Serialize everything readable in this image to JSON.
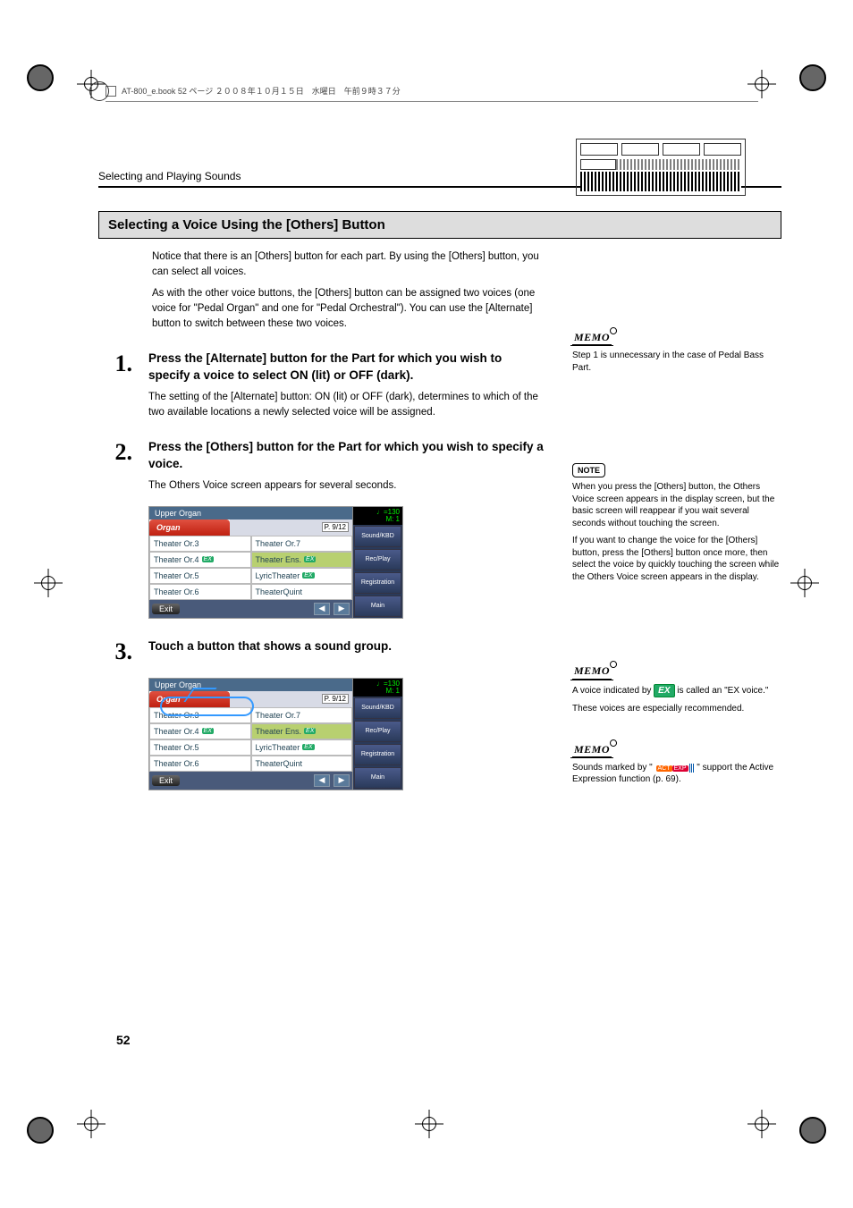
{
  "book_header": "AT-800_e.book  52 ページ  ２００８年１０月１５日　水曜日　午前９時３７分",
  "running_title": "Selecting and Playing Sounds",
  "section_title": "Selecting a Voice Using the [Others] Button",
  "intro_p1": "Notice that there is an [Others] button for each part. By using the [Others] button, you can select all voices.",
  "intro_p2": "As with the other voice buttons, the [Others] button can be assigned two voices (one voice for \"Pedal Organ\" and one for \"Pedal Orchestral\"). You can use the [Alternate] button to switch between these two voices.",
  "steps": {
    "s1": {
      "num": "1.",
      "instr": "Press the [Alternate] button for the Part for which you wish to specify a voice to select ON (lit) or OFF (dark).",
      "desc": "The setting of the [Alternate] button: ON (lit) or OFF (dark), determines to which of the two available locations a newly selected voice will be assigned."
    },
    "s2": {
      "num": "2.",
      "instr": "Press the [Others] button for the Part for which you wish to specify a voice.",
      "desc": "The Others Voice screen appears for several seconds."
    },
    "s3": {
      "num": "3.",
      "instr": "Touch a button that shows a sound group."
    }
  },
  "screen": {
    "title": "Upper Organ",
    "tab": "Organ",
    "page_ind": "P. 9/12",
    "cells": [
      {
        "l": "Theater Or.3",
        "ex": false
      },
      {
        "l": "Theater Or.7",
        "ex": false
      },
      {
        "l": "Theater Or.4",
        "ex": true
      },
      {
        "l": "Theater Ens.",
        "ex": true,
        "sel": true
      },
      {
        "l": "Theater Or.5",
        "ex": false
      },
      {
        "l": "LyricTheater",
        "ex": true
      },
      {
        "l": "Theater Or.6",
        "ex": false
      },
      {
        "l": "TheaterQuint",
        "ex": false
      }
    ],
    "exit": "Exit",
    "tempo_l1": "♩=130",
    "tempo_l2": "M:    1",
    "rbtns": [
      "Sound/KBD",
      "Rec/Play",
      "Registration",
      "Main"
    ]
  },
  "side": {
    "memo1": {
      "label": "MEMO",
      "text": "Step 1 is unnecessary in the case of Pedal Bass Part."
    },
    "note": {
      "label": "NOTE",
      "p1": "When you press the [Others] button, the Others Voice screen appears in the display screen, but the basic screen will reappear if you wait several seconds without touching the screen.",
      "p2": "If you want to change the voice for the [Others] button, press the [Others] button once more, then select the voice by quickly touching the screen while the Others Voice screen appears in the display."
    },
    "memo2": {
      "label": "MEMO",
      "pre": "A voice indicated by ",
      "post": " is called an \"EX voice.\"",
      "line2": "These voices are especially recommended."
    },
    "memo3": {
      "label": "MEMO",
      "pre": "Sounds marked by \"",
      "post": "\" support the Active Expression function (p. 69)."
    }
  },
  "page_number": "52",
  "ex_badge": "EX",
  "act_badge": {
    "a": "ACT",
    "e": "EXP"
  }
}
